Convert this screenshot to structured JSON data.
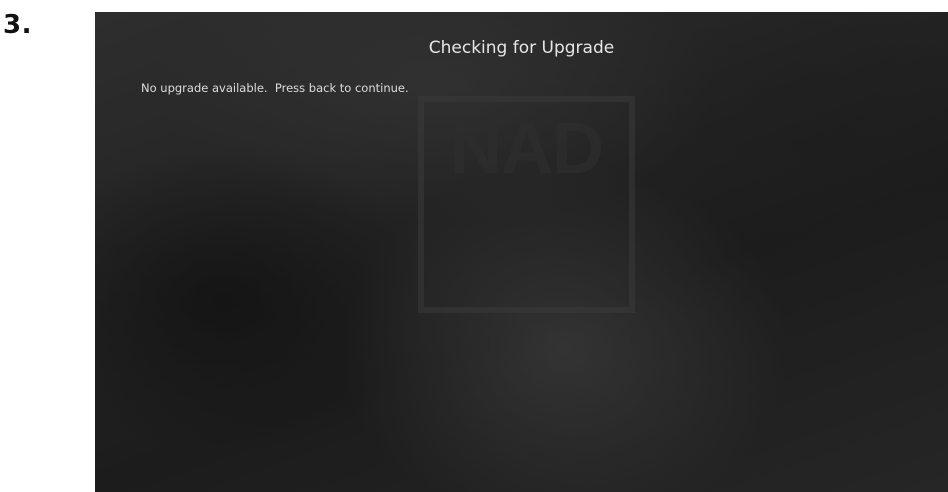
{
  "step": {
    "label": "3."
  },
  "screen": {
    "logo_text": "NAD",
    "title": "Checking for Upgrade",
    "message": "No upgrade available.  Press back to continue."
  }
}
